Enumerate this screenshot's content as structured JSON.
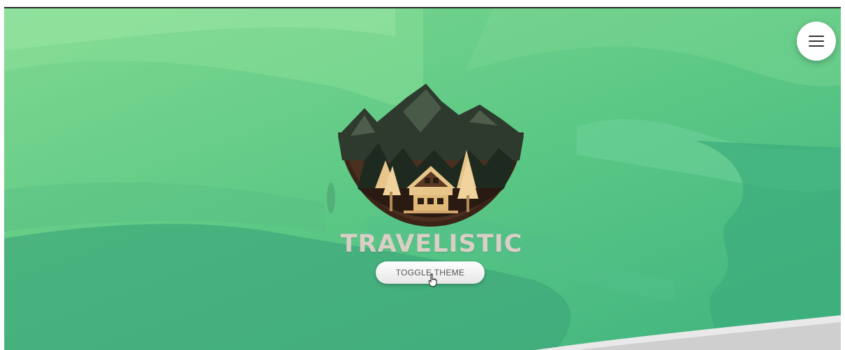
{
  "brand": {
    "name": "TRAVELISTIC"
  },
  "hero": {
    "toggle_button_label": "TOGGLE THEME"
  },
  "icons": {
    "menu": "hamburger-menu-icon",
    "logo": "mountain-cabin-logo",
    "cursor": "hand-pointer-cursor-icon"
  },
  "colors": {
    "hero_green": "#5fca86",
    "brand_text": "#d9cfc6",
    "button_bg": "#ffffff"
  }
}
